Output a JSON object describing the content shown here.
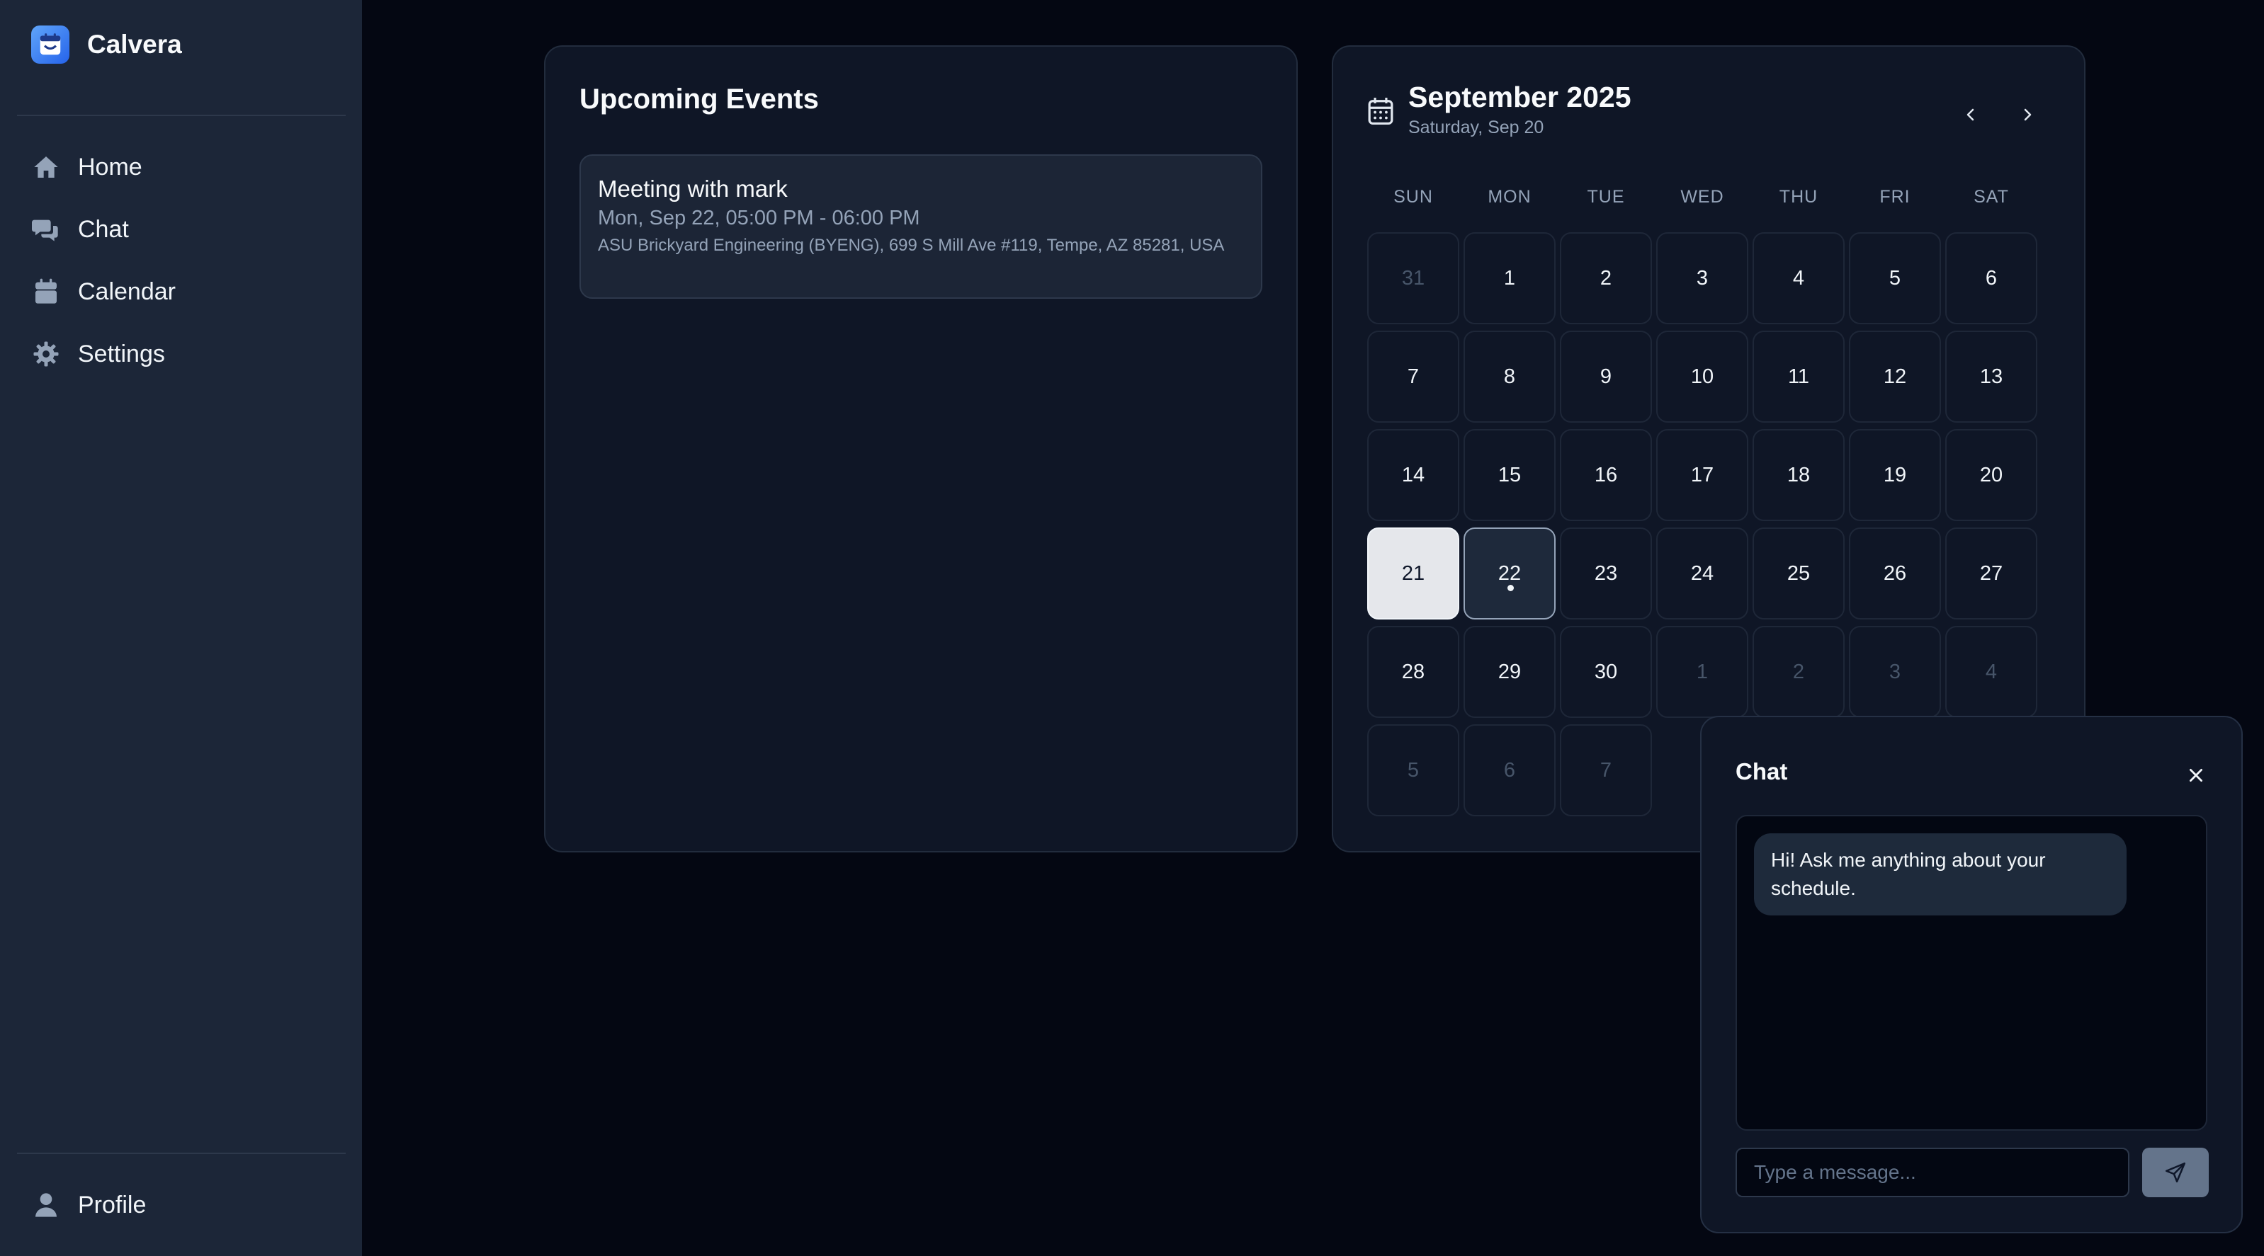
{
  "app": {
    "name": "Calvera",
    "logo_icon": "calendar-logo-icon",
    "accent": "#3b82f6"
  },
  "sidebar": {
    "items": [
      {
        "label": "Home",
        "icon": "home-icon"
      },
      {
        "label": "Chat",
        "icon": "chat-icon"
      },
      {
        "label": "Calendar",
        "icon": "calendar-icon"
      },
      {
        "label": "Settings",
        "icon": "gear-icon"
      }
    ],
    "profile": {
      "label": "Profile",
      "icon": "user-icon"
    }
  },
  "events": {
    "title": "Upcoming Events",
    "items": [
      {
        "title": "Meeting with mark",
        "time": "Mon, Sep 22, 05:00 PM - 06:00 PM",
        "location": "ASU Brickyard Engineering (BYENG), 699 S Mill Ave #119, Tempe, AZ 85281, USA"
      }
    ]
  },
  "calendar": {
    "month_label": "September 2025",
    "selected_label": "Saturday, Sep 20",
    "weekdays": [
      "SUN",
      "MON",
      "TUE",
      "WED",
      "THU",
      "FRI",
      "SAT"
    ],
    "today": 21,
    "selected": 22,
    "event_days": [
      22
    ],
    "weeks": [
      [
        "31",
        "1",
        "2",
        "3",
        "4",
        "5",
        "6"
      ],
      [
        "7",
        "8",
        "9",
        "10",
        "11",
        "12",
        "13"
      ],
      [
        "14",
        "15",
        "16",
        "17",
        "18",
        "19",
        "20"
      ],
      [
        "21",
        "22",
        "23",
        "24",
        "25",
        "26",
        "27"
      ],
      [
        "28",
        "29",
        "30",
        "1",
        "2",
        "3",
        "4"
      ],
      [
        "5",
        "6",
        "7"
      ]
    ],
    "outside_month": [
      [
        0,
        0
      ],
      [
        4,
        3
      ],
      [
        4,
        4
      ],
      [
        4,
        5
      ],
      [
        4,
        6
      ],
      [
        5,
        0
      ],
      [
        5,
        1
      ],
      [
        5,
        2
      ]
    ]
  },
  "chat": {
    "title": "Chat",
    "messages": [
      {
        "from": "assistant",
        "text": "Hi! Ask me anything about your schedule."
      }
    ],
    "input_placeholder": "Type a message...",
    "input_value": ""
  }
}
